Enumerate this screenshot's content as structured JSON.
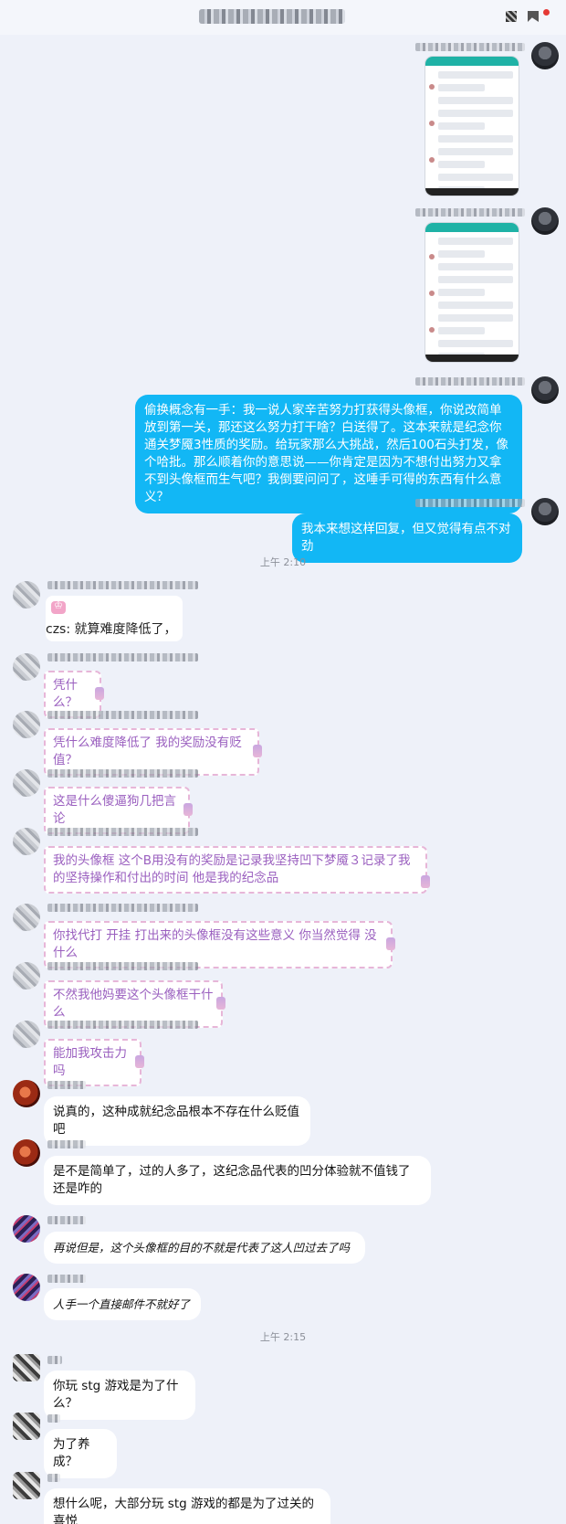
{
  "header": {
    "title": "",
    "status_dot_color": "#e53935"
  },
  "colors": {
    "my_bubble": "#12b7f5",
    "bg": "#eef1f9"
  },
  "times": [
    "上午 2:10",
    "上午 2:15"
  ],
  "messages": {
    "my_long": "偷换概念有一手：我一说人家辛苦努力打获得头像框，你说改简单放到第一关，那还这么努力打干啥？白送得了。这本来就是纪念你通关梦魇3性质的奖励。给玩家那么大挑战，然后100石头打发，像个哈批。那么顺着你的意思说——你肯定是因为不想付出努力又拿不到头像框而生气吧？我倒要问问了，这唾手可得的东西有什么意义？",
    "my_short": "我本来想这样回复，但又觉得有点不对劲",
    "quote": "czs: 就算难度降低了，",
    "pink": [
      "凭什么？",
      "凭什么难度降低了 我的奖励没有贬值？",
      "这是什么傻逼狗几把言论",
      "我的头像框 这个B用没有的奖励是记录我坚持凹下梦魇３记录了我的坚持操作和付出的时间 他是我的纪念品",
      "你找代打 开挂 打出来的头像框没有这些意义 你当然觉得 没什么",
      "不然我他妈要这个头像框干什么",
      "能加我攻击力吗"
    ],
    "w1": "说真的，这种成就纪念品根本不存在什么贬值吧",
    "w2": "是不是简单了，过的人多了，这纪念品代表的凹分体验就不值钱了还是咋的",
    "w3": "再说但是，这个头像框的目的不就是代表了这人凹过去了吗",
    "w4": "人手一个直接邮件不就好了",
    "w5": "你玩 stg 游戏是为了什么？",
    "w6": "为了养成？",
    "w7": "想什么呢，大部分玩 stg 游戏的都是为了过关的喜悦"
  }
}
